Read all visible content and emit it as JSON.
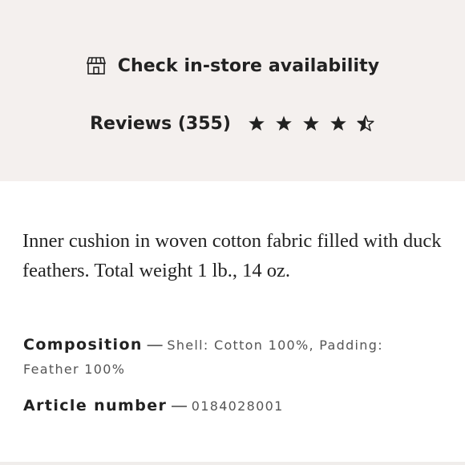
{
  "store_availability": {
    "label": "Check in-store availability",
    "icon": "store-icon"
  },
  "reviews": {
    "label": "Reviews (355)",
    "rating": 4.5,
    "max_rating": 5
  },
  "description": "Inner cushion in woven cotton fabric filled with duck feathers. Total weight 1 lb., 14 oz.",
  "details": {
    "composition_label": "Composition",
    "composition_value": "Shell: Cotton 100%, Padding: Feather 100%",
    "article_label": "Article number",
    "article_value": "0184028001",
    "separator": "—"
  },
  "colors": {
    "panel_background": "#f4f0ee",
    "text_primary": "#222222",
    "text_secondary": "#555555"
  }
}
